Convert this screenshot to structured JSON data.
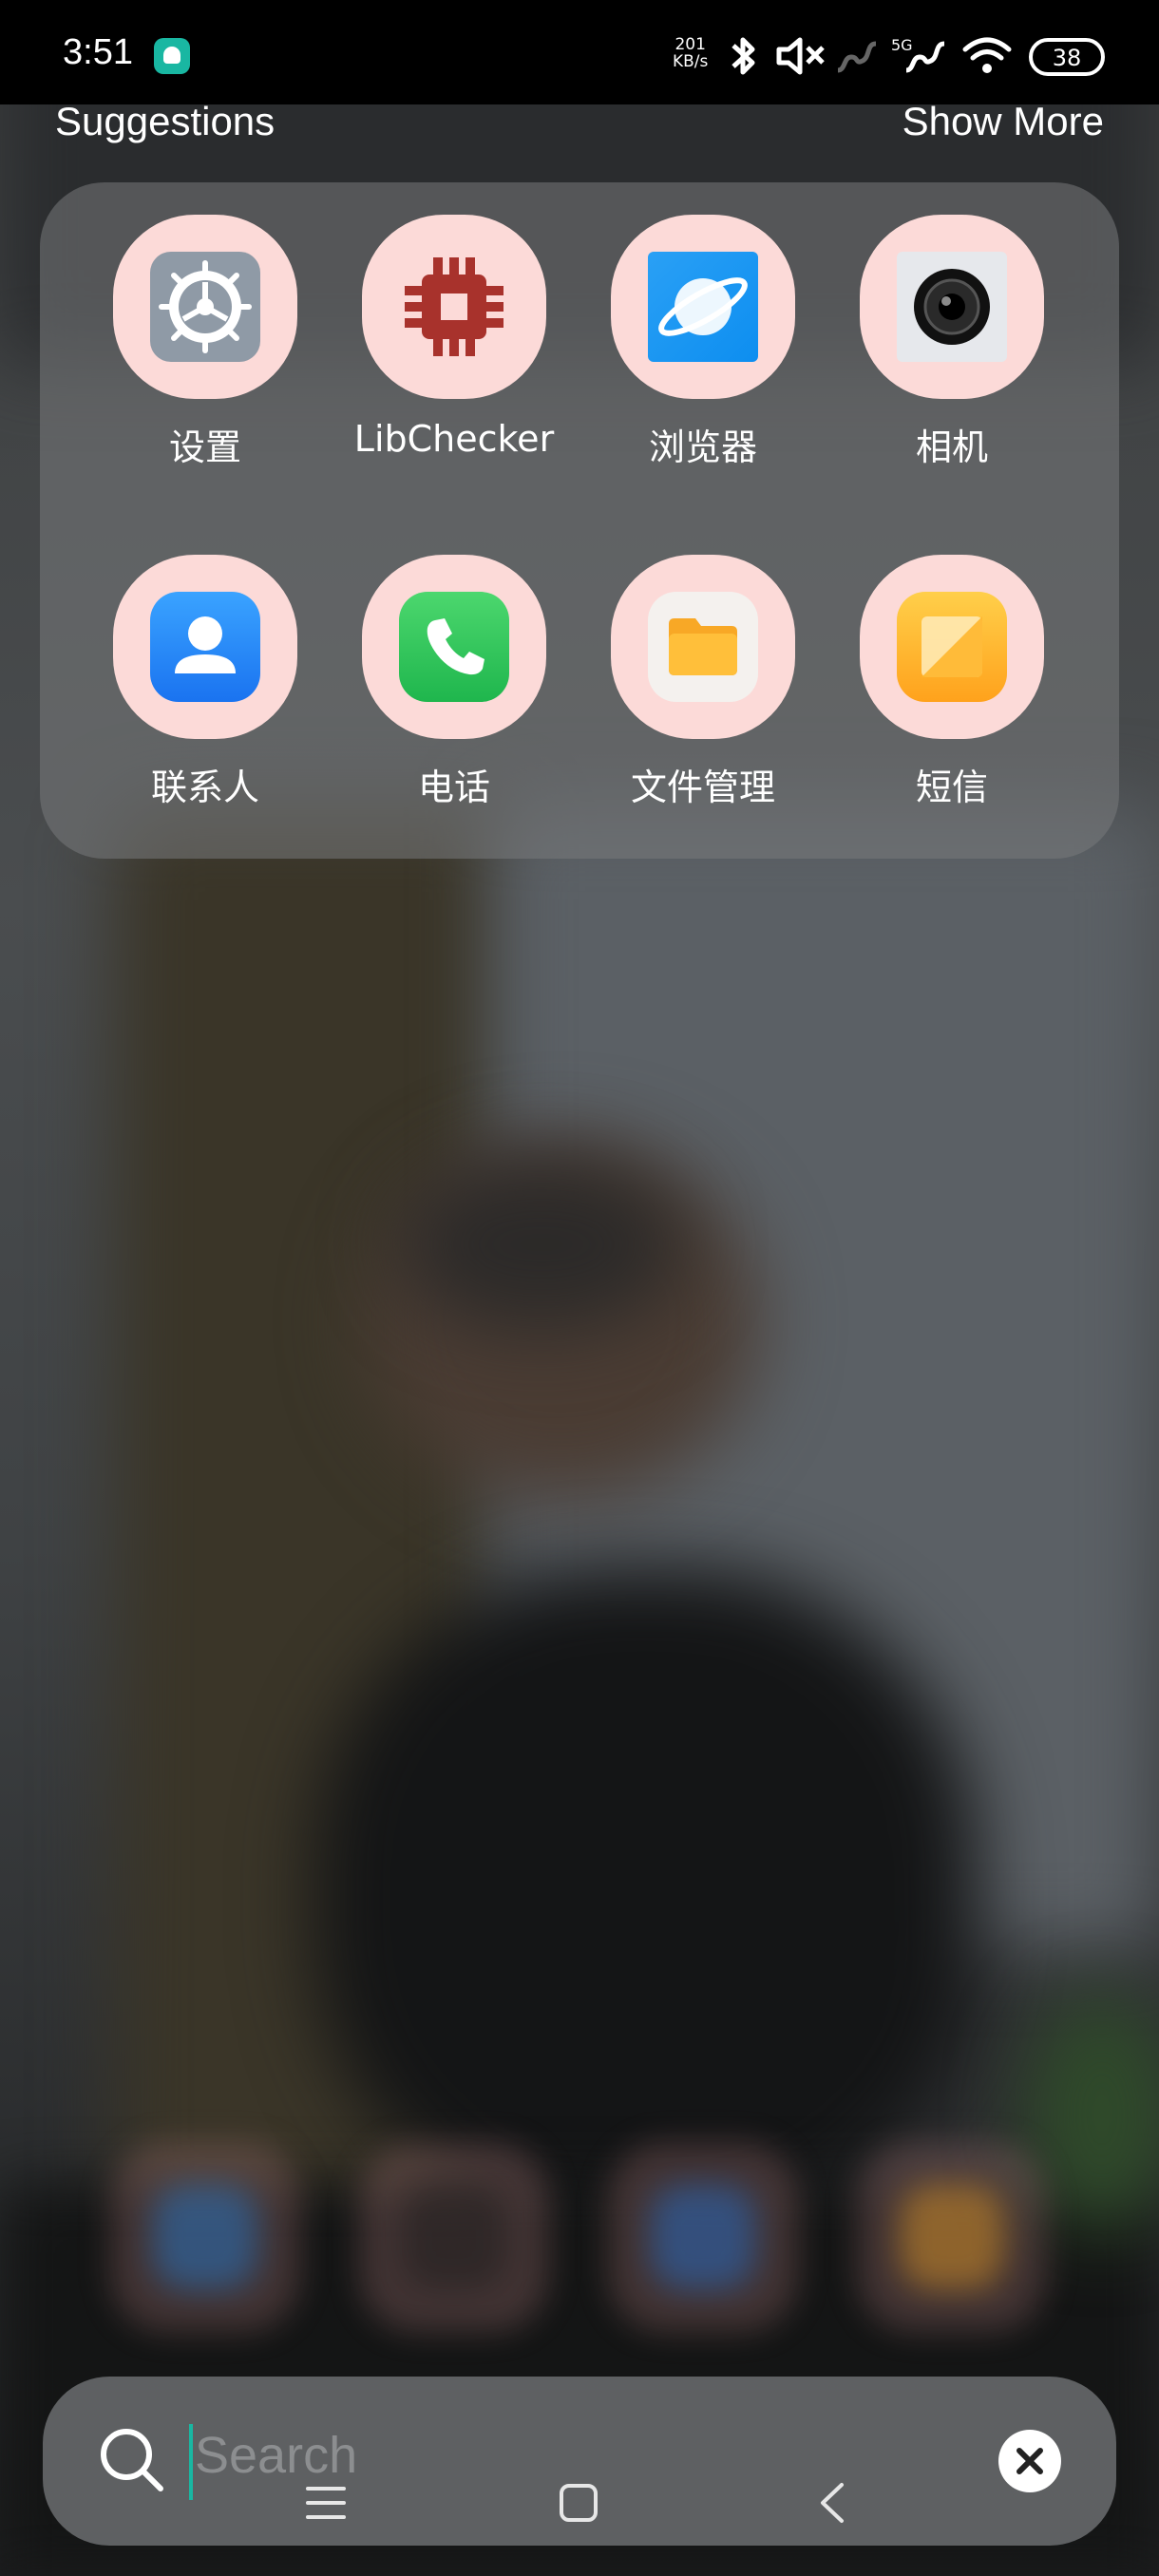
{
  "status_bar": {
    "time": "3:51",
    "net_speed_value": "201",
    "net_speed_unit": "KB/s",
    "network_label": "5G",
    "battery_level": "38"
  },
  "suggestions": {
    "title": "Suggestions",
    "show_more_label": "Show More",
    "apps": [
      {
        "label": "设置",
        "icon": "settings-icon"
      },
      {
        "label": "LibChecker",
        "icon": "libchecker-icon"
      },
      {
        "label": "浏览器",
        "icon": "browser-icon"
      },
      {
        "label": "相机",
        "icon": "camera-icon"
      },
      {
        "label": "联系人",
        "icon": "contacts-icon"
      },
      {
        "label": "电话",
        "icon": "phone-icon"
      },
      {
        "label": "文件管理",
        "icon": "file-manager-icon"
      },
      {
        "label": "短信",
        "icon": "messages-icon"
      }
    ]
  },
  "search": {
    "placeholder": "Search"
  },
  "colors": {
    "accent": "#19b7a2",
    "icon_bg": "#fcdad8"
  }
}
